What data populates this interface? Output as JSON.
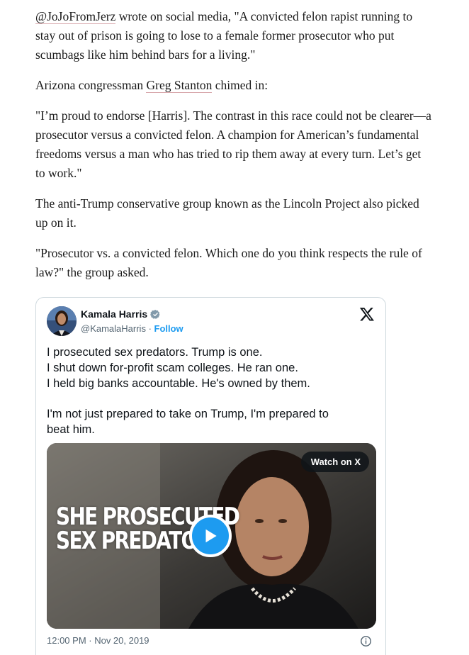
{
  "article": {
    "p1": {
      "handle": "@JoJoFromJerz",
      "text": " wrote on social media, \"A convicted felon rapist running to stay out of prison is going to lose to a female former prosecutor who put scumbags like him behind bars for a living.\""
    },
    "p2": {
      "before": "Arizona congressman ",
      "link": "Greg Stanton",
      "after": " chimed in:"
    },
    "p3": "\"I’m proud to endorse [Harris]. The contrast in this race could not be clearer—a prosecutor versus a convicted felon. A champion for American’s fundamental freedoms versus a man who has tried to rip them away at every turn. Let’s get to work.\"",
    "p4": "The anti-Trump conservative group known as the Lincoln Project also picked up on it.",
    "p5": "\"Prosecutor vs. a convicted felon. Which one do you think respects the rule of law?\" the group asked."
  },
  "tweet": {
    "name": "Kamala Harris",
    "handle": "@KamalaHarris",
    "separator": " · ",
    "follow_label": "Follow",
    "lines": [
      "I prosecuted sex predators. Trump is one.",
      "I shut down for-profit scam colleges. He ran one.",
      "I held big banks accountable. He's owned by them."
    ],
    "lines2": [
      "I'm not just prepared to take on Trump, I'm prepared to",
      "beat him."
    ],
    "media": {
      "watch_label": "Watch on X",
      "overlay_line1": "SHE PROSECUTED",
      "overlay_line2": "SEX PREDATORS"
    },
    "timestamp": "12:00 PM · Nov 20, 2019",
    "icons": {
      "verified": "verified-badge-icon",
      "x": "x-logo-icon",
      "play": "play-icon",
      "info": "info-icon"
    },
    "colors": {
      "accent": "#1d9bf0",
      "muted": "#536471",
      "text": "#0f1419"
    }
  }
}
